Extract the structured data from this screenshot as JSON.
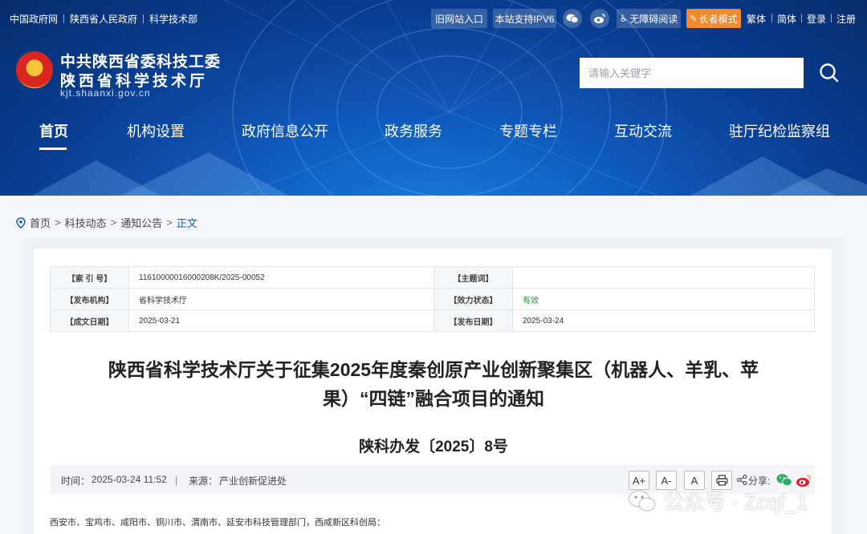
{
  "topbar": {
    "links": [
      "中国政府网",
      "陕西省人民政府",
      "科学技术部"
    ],
    "old_site": "旧网站入口",
    "ipv6": "本站支持IPV6",
    "accessibility": "无障碍阅读",
    "elder_mode": "长者模式",
    "traditional": "繁体",
    "simplified": "简体",
    "login": "登录",
    "register": "注册"
  },
  "site": {
    "name_line1": "中共陕西省委科技工委",
    "name_line2": "陕西省科学技术厅",
    "url": "kjt.shaanxi.gov.cn"
  },
  "search": {
    "placeholder": "请输入关键字"
  },
  "nav": {
    "items": [
      "首页",
      "机构设置",
      "政府信息公开",
      "政务服务",
      "专题专栏",
      "互动交流",
      "驻厅纪检监察组"
    ],
    "active": "首页"
  },
  "breadcrumb": {
    "items": [
      "首页",
      "科技动态",
      "通知公告"
    ],
    "current": "正文"
  },
  "meta": {
    "index_label": "【索 引 号】",
    "index_value": "11610000016000208K/2025-00052",
    "subject_label": "【主题词】",
    "subject_value": "",
    "publisher_label": "【发布机构】",
    "publisher_value": "省科学技术厅",
    "validity_label": "【效力状态】",
    "validity_value": "有效",
    "created_label": "【成文日期】",
    "created_value": "2025-03-21",
    "published_label": "【发布日期】",
    "published_value": "2025-03-24"
  },
  "document": {
    "title": "陕西省科学技术厅关于征集2025年度秦创原产业创新聚集区（机器人、羊乳、苹果）“四链”融合项目的通知",
    "number": "陕科办发〔2025〕8号",
    "time_label": "时间：",
    "time_value": "2025-03-24 11:52",
    "separator": "|",
    "source_label": "来源：",
    "source_value": "产业创新促进处",
    "share_label": "分享:",
    "body_first_line": "西安市、宝鸡市、咸阳市、铜川市、渭南市、延安市科技管理部门，西咸新区科创局："
  },
  "tools": {
    "font_large": "A+",
    "font_small": "A-",
    "font_normal": "A"
  },
  "watermark": {
    "text": "公众号 · Zcqf_1"
  },
  "colors": {
    "header_blue": "#0a3f94",
    "accent_orange": "#f08a2d",
    "link_blue": "#1a5fb4",
    "valid_green": "#2e8b3e"
  }
}
